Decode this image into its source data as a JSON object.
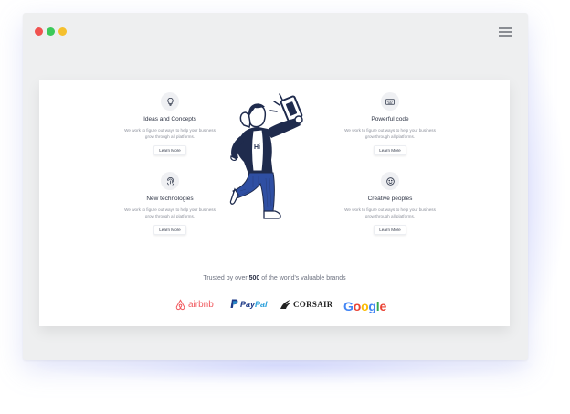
{
  "window": {
    "controls": [
      "close",
      "maximize",
      "minimize"
    ],
    "menu_icon": "hamburger-menu-icon"
  },
  "features": [
    {
      "icon": "lightbulb-icon",
      "title": "Ideas and Concepts",
      "description": "We work to figure out ways to help your business grow through all platforms.",
      "button": "Learn More"
    },
    {
      "icon": "fingerprint-icon",
      "title": "New technologies",
      "description": "We work to figure out ways to help your business grow through all platforms.",
      "button": "Learn More"
    },
    {
      "icon": "keyboard-icon",
      "title": "Powerful code",
      "description": "We work to figure out ways to help your business grow through all platforms.",
      "button": "Learn More"
    },
    {
      "icon": "smiley-icon",
      "title": "Creative peoples",
      "description": "We work to figure out ways to help your business grow through all platforms.",
      "button": "Learn More"
    }
  ],
  "illustration": {
    "shirt_text": "Hi"
  },
  "trusted": {
    "prefix": "Trusted by over",
    "count": "500",
    "suffix": "of the world's valuable brands"
  },
  "brands": {
    "airbnb": "airbnb",
    "paypal_dark": "Pay",
    "paypal_light": "Pal",
    "corsair": "CORSAIR",
    "google": [
      "G",
      "o",
      "o",
      "g",
      "l",
      "e"
    ]
  },
  "colors": {
    "accent_dark": "#1f2b4d",
    "jeans": "#2f4fa3",
    "airbnb": "#f05a5f",
    "paypal_dark": "#1e3a87",
    "paypal_light": "#2ba0db"
  }
}
